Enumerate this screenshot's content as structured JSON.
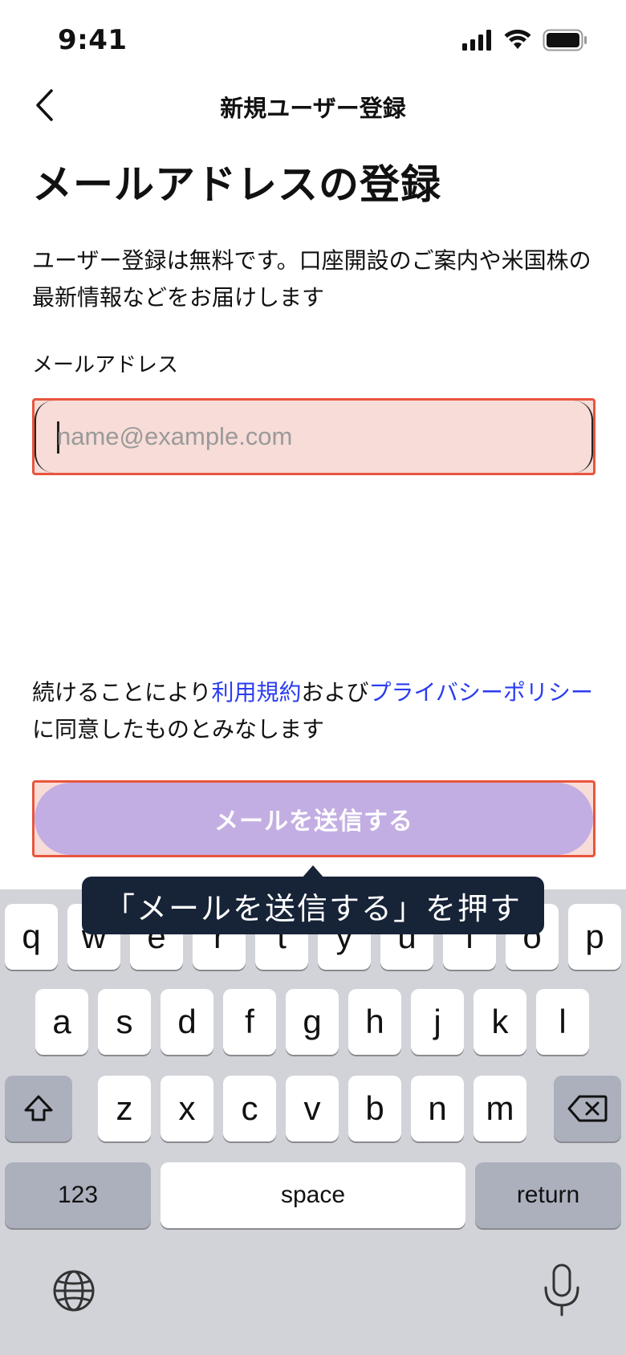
{
  "status_bar": {
    "time": "9:41"
  },
  "nav": {
    "title": "新規ユーザー登録"
  },
  "main": {
    "heading": "メールアドレスの登録",
    "description": "ユーザー登録は無料です。口座開設のご案内や米国株の最新情報などをお届けします",
    "email_label": "メールアドレス",
    "email_placeholder": "name@example.com",
    "email_value": ""
  },
  "terms": {
    "prefix": "続けることにより",
    "terms_link": "利用規約",
    "middle": "および",
    "privacy_link": "プライバシーポリシー",
    "suffix": "に同意したものとみなします"
  },
  "send_button": {
    "label": "メールを送信する"
  },
  "tooltip": {
    "text": "「メールを送信する」を押す"
  },
  "keyboard": {
    "row1": [
      "q",
      "w",
      "e",
      "r",
      "t",
      "y",
      "u",
      "i",
      "o",
      "p"
    ],
    "row2": [
      "a",
      "s",
      "d",
      "f",
      "g",
      "h",
      "j",
      "k",
      "l"
    ],
    "row3": [
      "z",
      "x",
      "c",
      "v",
      "b",
      "n",
      "m"
    ],
    "numbers_label": "123",
    "space_label": "space",
    "return_label": "return"
  },
  "colors": {
    "highlight_border": "#e8553e",
    "highlight_fill": "#f7dcd7",
    "button_disabled": "#c3aee3",
    "link": "#2a3df0",
    "tooltip_bg": "#172337",
    "keyboard_bg": "#d1d3d9"
  }
}
